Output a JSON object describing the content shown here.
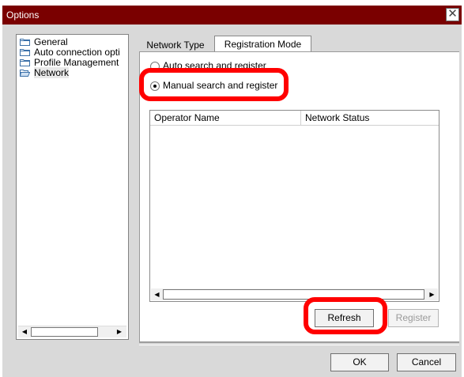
{
  "window": {
    "title": "Options",
    "close_glyph": "✕"
  },
  "tree": {
    "items": [
      {
        "label": "General",
        "icon": "folder-icon"
      },
      {
        "label": "Auto connection opti",
        "icon": "folder-icon"
      },
      {
        "label": "Profile Management",
        "icon": "folder-icon"
      },
      {
        "label": "Network",
        "icon": "folder-open-icon",
        "selected": true
      }
    ]
  },
  "tabs": [
    {
      "label": "Network Type",
      "active": false
    },
    {
      "label": "Registration Mode",
      "active": true
    }
  ],
  "registration": {
    "option_auto": "Auto search and register",
    "option_manual": "Manual search and register",
    "selected": "manual"
  },
  "operator_list": {
    "columns": [
      "Operator Name",
      "Network Status"
    ],
    "rows": []
  },
  "buttons": {
    "refresh": "Refresh",
    "register": "Register",
    "ok": "OK",
    "cancel": "Cancel"
  },
  "colors": {
    "titlebar": "#7a0000",
    "highlight": "#ff0000"
  }
}
